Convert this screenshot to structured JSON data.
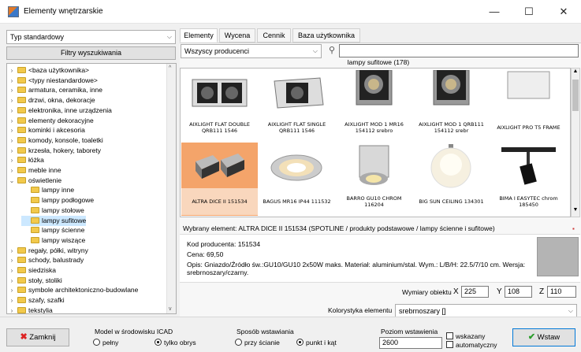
{
  "window": {
    "title": "Elementy wnętrzarskie",
    "minimize": "—",
    "maximize": "☐",
    "close": "✕"
  },
  "left": {
    "type_select": "Typ standardowy",
    "filter_button": "Filtry wyszukiwania",
    "tree": [
      {
        "label": "<baza użytkownika>",
        "level": 0,
        "expanded": false
      },
      {
        "label": "<typy niestandardowe>",
        "level": 0,
        "expanded": false
      },
      {
        "label": "armatura, ceramika, inne",
        "level": 0,
        "expanded": false
      },
      {
        "label": "drzwi, okna, dekoracje",
        "level": 0,
        "expanded": false
      },
      {
        "label": "elektronika, inne urządzenia",
        "level": 0,
        "expanded": false
      },
      {
        "label": "elementy dekoracyjne",
        "level": 0,
        "expanded": false
      },
      {
        "label": "kominki i akcesoria",
        "level": 0,
        "expanded": false
      },
      {
        "label": "komody, konsole, toaletki",
        "level": 0,
        "expanded": false
      },
      {
        "label": "krzesła, hokery, taborety",
        "level": 0,
        "expanded": false
      },
      {
        "label": "łóżka",
        "level": 0,
        "expanded": false
      },
      {
        "label": "meble inne",
        "level": 0,
        "expanded": false
      },
      {
        "label": "oświetlenie",
        "level": 0,
        "expanded": true
      },
      {
        "label": "lampy inne",
        "level": 1
      },
      {
        "label": "lampy podłogowe",
        "level": 1
      },
      {
        "label": "lampy stołowe",
        "level": 1
      },
      {
        "label": "lampy sufitowe",
        "level": 1,
        "selected": true
      },
      {
        "label": "lampy ścienne",
        "level": 1
      },
      {
        "label": "lampy wiszące",
        "level": 1
      },
      {
        "label": "regały, półki, witryny",
        "level": 0,
        "expanded": false
      },
      {
        "label": "schody, balustrady",
        "level": 0,
        "expanded": false
      },
      {
        "label": "siedziska",
        "level": 0,
        "expanded": false
      },
      {
        "label": "stoły, stoliki",
        "level": 0,
        "expanded": false
      },
      {
        "label": "symbole architektoniczno-budowlane",
        "level": 0,
        "expanded": false
      },
      {
        "label": "szafy, szafki",
        "level": 0,
        "expanded": false
      },
      {
        "label": "tekstylia",
        "level": 0,
        "expanded": false
      }
    ]
  },
  "tabs": [
    "Elementy",
    "Wycena",
    "Cennik",
    "Baza użytkownika"
  ],
  "producer_select": "Wszyscy producenci",
  "search_placeholder": "",
  "grid_header": "lampy sufitowe (178)",
  "items": [
    {
      "caption": "AIXLIGHT FLAT DOUBLE QRB111 1546",
      "kind": "double-square"
    },
    {
      "caption": "AIXLIGHT FLAT SINGLE QRB111 1546",
      "kind": "single-square"
    },
    {
      "caption": "AIXLIGHT MOD 1 MR16 154112 srebro",
      "kind": "mod"
    },
    {
      "caption": "AIXLIGHT MOD 1 QRB111 154112 srebr",
      "kind": "mod"
    },
    {
      "caption": "AIXLIGHT PRO T5 FRAME",
      "kind": "frame"
    },
    {
      "caption": "ALTRA DICE II 151534",
      "kind": "dice",
      "selected": true
    },
    {
      "caption": "BAGUS MR16 IP44 111532",
      "kind": "bagus"
    },
    {
      "caption": "BARRO GU10 CHROM 116204",
      "kind": "barro"
    },
    {
      "caption": "BIG SUN CEILING 134301",
      "kind": "sun"
    },
    {
      "caption": "BIMA I EASYTEC chrom 185450",
      "kind": "bima"
    }
  ],
  "selected_info": "Wybrany element: ALTRA DICE II 151534        (SPOTLINE / produkty podstawowe / lampy ścienne i sufitowe)",
  "details": {
    "code": "Kod producenta: 151534",
    "price": "Cena: 69,50",
    "desc1": "Opis: Gniazdo/Źródło św.:GU10/GU10 2x50W maks. Materiał: aluminium/stal. Wym.: L/B/H: 22.5/7/10 cm. Wersja:",
    "desc2": "srebrnoszary/czarny.",
    "swatch_color": "#b4b4b4"
  },
  "dims": {
    "label": "Wymiary obiektu",
    "x_label": "X",
    "x": "225",
    "y_label": "Y",
    "y": "108",
    "z_label": "Z",
    "z": "110"
  },
  "color_row": {
    "label": "Kolorystyka elementu",
    "value": "srebrnoszary []"
  },
  "bottom": {
    "close_button": "Zamknij",
    "model_group": "Model w środowisku ICAD",
    "model_opt1": "pełny",
    "model_opt2": "tylko obrys",
    "insert_group": "Sposób wstawiania",
    "insert_opt1": "przy ścianie",
    "insert_opt2": "punkt i kąt",
    "level_label": "Poziom wstawienia",
    "level_value": "2600",
    "check_label1": "wskazany",
    "check_label2": "automatyczny",
    "insert_button": "Wstaw"
  },
  "colors": {
    "accent": "#f4a46a",
    "selection": "#cce8ff"
  }
}
